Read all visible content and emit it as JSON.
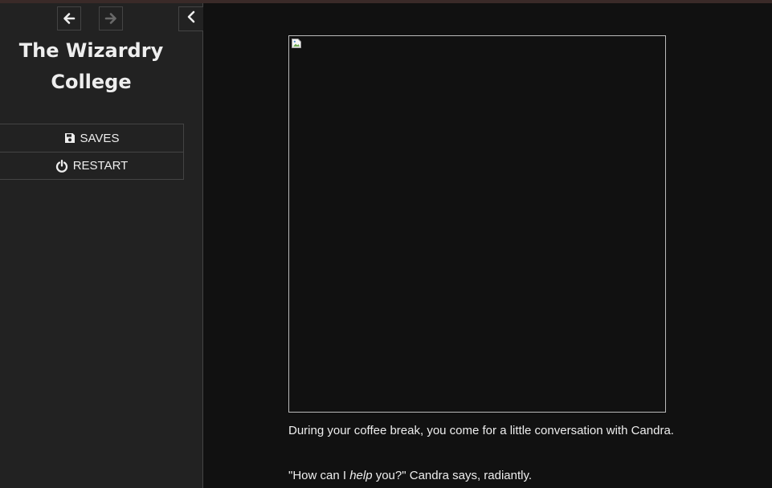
{
  "sidebar": {
    "story_title_line1": "The Wizardry",
    "story_title_line2": "College",
    "menu": {
      "saves_label": "SAVES",
      "restart_label": "RESTART"
    }
  },
  "passage": {
    "line1": "During your coffee break, you come for a little conversation with Candra.",
    "line2_before": "\"How can I ",
    "line2_emphasis": "help",
    "line2_after": " you?\" Candra says, radiantly."
  }
}
